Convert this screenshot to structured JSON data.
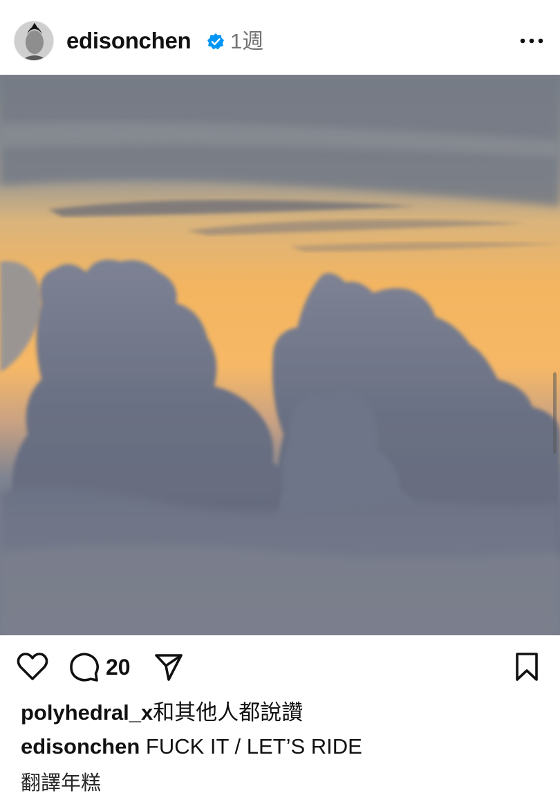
{
  "post": {
    "username": "edisonchen",
    "time_ago": "1週",
    "verified": true,
    "more_icon": "more-horizontal-icon"
  },
  "photo": {
    "alt": "sunset above clouds"
  },
  "actions": {
    "like_icon": "heart-icon",
    "comment_icon": "comment-icon",
    "comment_count": "20",
    "share_icon": "send-icon",
    "save_icon": "bookmark-icon"
  },
  "likes": {
    "user": "polyhedral_x",
    "suffix": "和其他人都說讚"
  },
  "caption": {
    "user": "edisonchen",
    "text": "FUCK IT / LET’S RIDE"
  },
  "translate_label": "翻譯年糕",
  "colors": {
    "verified_blue": "#0095f6",
    "meta_gray": "#737373",
    "sky_orange": "#f7b25f"
  }
}
